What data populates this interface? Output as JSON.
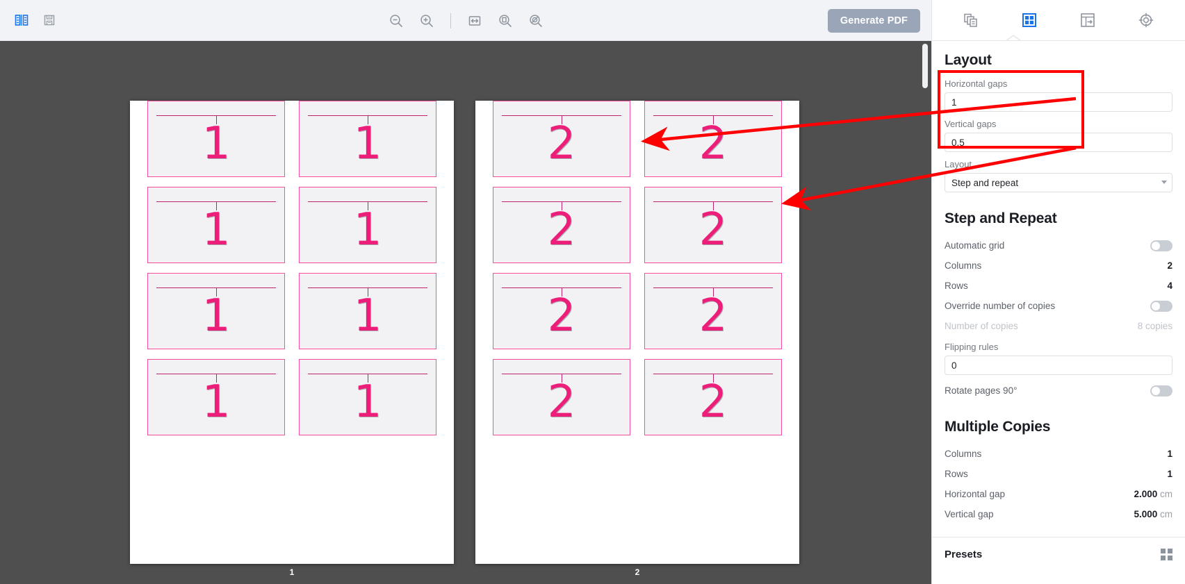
{
  "toolbar": {
    "left_icons": [
      {
        "name": "split-view-icon",
        "label": "Split view"
      },
      {
        "name": "save-icon",
        "label": "Save"
      }
    ],
    "center_icons": [
      {
        "name": "zoom-out-icon",
        "label": "Zoom out"
      },
      {
        "name": "zoom-in-icon",
        "label": "Zoom in"
      },
      {
        "name": "fit-width-icon",
        "label": "Fit width"
      },
      {
        "name": "fit-page-icon",
        "label": "Fit page"
      },
      {
        "name": "actual-size-icon",
        "label": "Actual size"
      }
    ],
    "generate_pdf_label": "Generate PDF"
  },
  "canvas": {
    "pages": [
      {
        "label": "1",
        "cards": [
          {
            "number": "1"
          },
          {
            "number": "1"
          },
          {
            "number": "1"
          },
          {
            "number": "1"
          },
          {
            "number": "1"
          },
          {
            "number": "1"
          },
          {
            "number": "1"
          },
          {
            "number": "1"
          }
        ]
      },
      {
        "label": "2",
        "cards": [
          {
            "number": "2"
          },
          {
            "number": "2"
          },
          {
            "number": "2"
          },
          {
            "number": "2"
          },
          {
            "number": "2"
          },
          {
            "number": "2"
          },
          {
            "number": "2"
          },
          {
            "number": "2"
          }
        ]
      }
    ]
  },
  "panel": {
    "tabs": [
      {
        "name": "pages-icon",
        "label": "Pages",
        "active": false
      },
      {
        "name": "layout-grid-icon",
        "label": "Layout",
        "active": true
      },
      {
        "name": "imposition-icon",
        "label": "Imposition",
        "active": false
      },
      {
        "name": "marks-target-icon",
        "label": "Marks",
        "active": false
      }
    ],
    "layout": {
      "title": "Layout",
      "horizontal_gaps_label": "Horizontal gaps",
      "horizontal_gaps_value": "1",
      "vertical_gaps_label": "Vertical gaps",
      "vertical_gaps_value": "0.5",
      "layout_label": "Layout",
      "layout_value": "Step and repeat",
      "layout_options": [
        "Step and repeat"
      ]
    },
    "step_and_repeat": {
      "title": "Step and Repeat",
      "rows": [
        {
          "key": "Automatic grid",
          "type": "toggle",
          "value": "off",
          "dim": false
        },
        {
          "key": "Columns",
          "type": "value",
          "value": "2",
          "dim": false
        },
        {
          "key": "Rows",
          "type": "value",
          "value": "4",
          "dim": false
        },
        {
          "key": "Override number of copies",
          "type": "toggle",
          "value": "off",
          "dim": false
        },
        {
          "key": "Number of copies",
          "type": "value",
          "value": "8 copies",
          "dim": true
        }
      ],
      "flipping_rules_label": "Flipping rules",
      "flipping_rules_value": "0",
      "rotate_label": "Rotate pages 90°",
      "rotate_value": "off"
    },
    "multiple_copies": {
      "title": "Multiple Copies",
      "rows": [
        {
          "key": "Columns",
          "value": "1",
          "unit": ""
        },
        {
          "key": "Rows",
          "value": "1",
          "unit": ""
        },
        {
          "key": "Horizontal gap",
          "value": "2.000",
          "unit": "cm"
        },
        {
          "key": "Vertical gap",
          "value": "5.000",
          "unit": "cm"
        }
      ]
    },
    "presets": {
      "title": "Presets",
      "grid_icon": "presets-grid-icon"
    }
  },
  "annotations": {
    "highlight_color": "#ff0000",
    "arrow_count": 2
  },
  "colors": {
    "accent_blue": "#1a73e8",
    "card_border_pink": "#f74fa0",
    "card_number_pink": "#ec1e79",
    "card_rule_pink": "#c0216d",
    "canvas_bg": "#4f4f4f",
    "toolbar_bg": "#f1f3f6",
    "generate_pdf_bg": "#9aa5b7",
    "annotation_red": "#ff0000"
  }
}
